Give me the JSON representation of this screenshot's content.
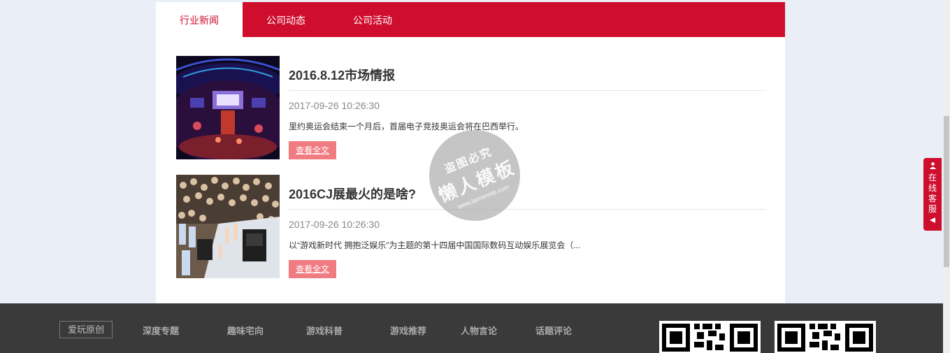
{
  "tabs": [
    {
      "label": "行业新闻",
      "active": true
    },
    {
      "label": "公司动态",
      "active": false
    },
    {
      "label": "公司活动",
      "active": false
    }
  ],
  "news": [
    {
      "title": "2016.8.12市场情报",
      "date": "2017-09-26 10:26:30",
      "summary": "里约奥运会结束一个月后，首届电子竞技奥运会将在巴西举行。",
      "button": "查看全文",
      "image": "esports-arena-image"
    },
    {
      "title": "2016CJ展最火的是啥?",
      "date": "2017-09-26 10:26:30",
      "summary": "以“游戏新时代 拥抱泛娱乐”为主题的第十四届中国国际数码互动娱乐展览会（...",
      "button": "查看全文",
      "image": "expo-crowd-image"
    }
  ],
  "watermark": {
    "top": "盗图必究",
    "main": "懒人模板",
    "url": "www.lanrenmb.com"
  },
  "side_service": {
    "label": "在线客服",
    "icon": "person-icon"
  },
  "footer": {
    "origin": "爱玩原创",
    "links": [
      "深度专题",
      "趣味宅向",
      "游戏科普",
      "游戏推荐",
      "人物言论",
      "话题评论"
    ]
  },
  "colors": {
    "brand_red": "#cf0e2e",
    "button_pink": "#f07b80",
    "footer_bg": "#3a3a3a",
    "page_bg": "#e9eef7"
  }
}
